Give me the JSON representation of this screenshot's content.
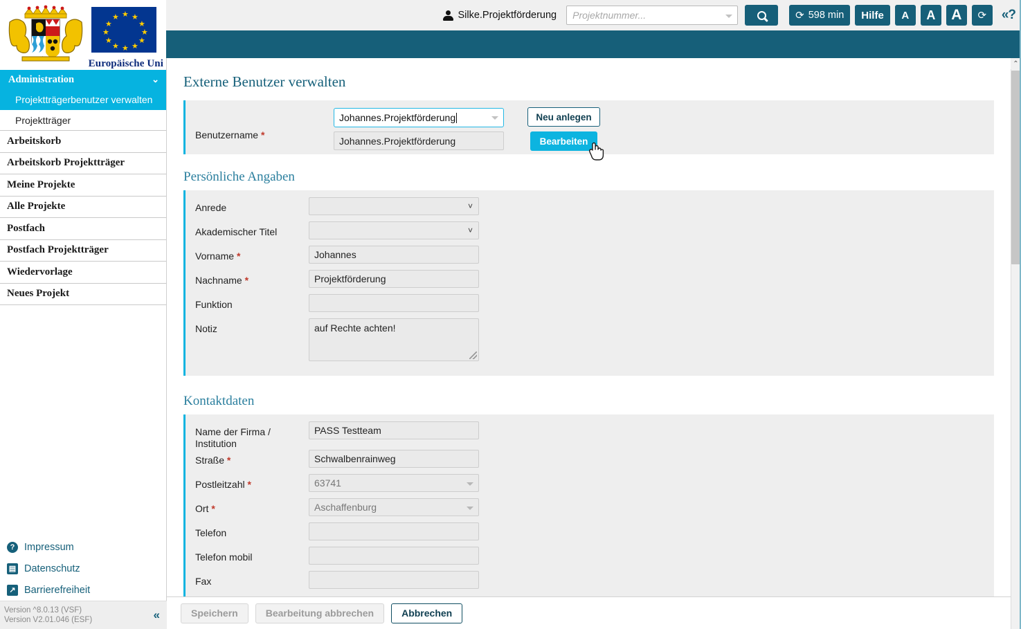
{
  "topbar": {
    "user_icon": "user-icon",
    "username": "Silke.Projektförderung",
    "search_placeholder": "Projektnummer...",
    "search_value": "",
    "search_button_icon": "search-icon",
    "timer_label": "598 min",
    "timer_icon": "refresh-icon",
    "help_label": "Hilfe",
    "font_small": "A",
    "font_medium": "A",
    "font_large": "A",
    "refresh_icon": "refresh-icon",
    "collapse_help": "«?"
  },
  "sidebar": {
    "coat_of_arms_alt": "bayern-coat-of-arms",
    "eu_flag_alt": "eu-flag",
    "eu_label": "Europäische Uni",
    "admin": {
      "label": "Administration",
      "chevron": "⌄"
    },
    "admin_children": [
      {
        "label": "Projektträgerbenutzer verwalten",
        "active": true
      },
      {
        "label": "Projektträger",
        "active": false
      }
    ],
    "items": [
      {
        "label": "Arbeitskorb"
      },
      {
        "label": "Arbeitskorb Projektträger"
      },
      {
        "label": "Meine Projekte"
      },
      {
        "label": "Alle Projekte"
      },
      {
        "label": "Postfach"
      },
      {
        "label": "Postfach Projektträger"
      },
      {
        "label": "Wiedervorlage"
      },
      {
        "label": "Neues Projekt"
      }
    ],
    "footer_links": [
      {
        "label": "Impressum",
        "icon": "question-mark-icon",
        "glyph": "?"
      },
      {
        "label": "Datenschutz",
        "icon": "document-icon",
        "glyph": "▤"
      },
      {
        "label": "Barrierefreiheit",
        "icon": "accessibility-arrow-icon",
        "glyph": "↗"
      }
    ],
    "version_line1": "Version ^8.0.13 (VSF)",
    "version_line2": "Version V2.01.046 (ESF)",
    "collapse_arrows": "«"
  },
  "main": {
    "page_title": "Externe Benutzer verwalten",
    "username_section": {
      "label": "Benutzername",
      "required": "*",
      "input_value": "Johannes.Projektförderung",
      "option_value": "Johannes.Projektförderung",
      "new_button": "Neu anlegen",
      "edit_button": "Bearbeiten"
    },
    "personal_section": {
      "title": "Persönliche Angaben",
      "fields": [
        {
          "label": "Anrede",
          "required": "",
          "value": "",
          "type": "select"
        },
        {
          "label": "Akademischer Titel",
          "required": "",
          "value": "",
          "type": "select"
        },
        {
          "label": "Vorname",
          "required": "*",
          "value": "Johannes",
          "type": "text"
        },
        {
          "label": "Nachname",
          "required": "*",
          "value": "Projektförderung",
          "type": "text"
        },
        {
          "label": "Funktion",
          "required": "",
          "value": "",
          "type": "text"
        },
        {
          "label": "Notiz",
          "required": "",
          "value": "auf Rechte achten!",
          "type": "textarea"
        }
      ]
    },
    "contact_section": {
      "title": "Kontaktdaten",
      "fields": [
        {
          "label": "Name der Firma / Institution",
          "required": "",
          "value": "PASS Testteam",
          "type": "text"
        },
        {
          "label": "Straße",
          "required": "*",
          "value": "Schwalbenrainweg",
          "type": "text"
        },
        {
          "label": "Postleitzahl",
          "required": "*",
          "value": "63741",
          "type": "combo-muted"
        },
        {
          "label": "Ort",
          "required": "*",
          "value": "Aschaffenburg",
          "type": "combo-muted"
        },
        {
          "label": "Telefon",
          "required": "",
          "value": "",
          "type": "text"
        },
        {
          "label": "Telefon mobil",
          "required": "",
          "value": "",
          "type": "text"
        },
        {
          "label": "Fax",
          "required": "",
          "value": "",
          "type": "text"
        }
      ]
    }
  },
  "actionbar": {
    "save": "Speichern",
    "cancel_edit": "Bearbeitung abbrechen",
    "cancel": "Abbrechen"
  },
  "scrollbar": {
    "up_arrow": "⌃"
  },
  "colors": {
    "teal": "#165f79",
    "cyan": "#0cb4e0",
    "panel_gray": "#eeeeee",
    "required_red": "#c0392b",
    "eu_blue": "#033690"
  }
}
